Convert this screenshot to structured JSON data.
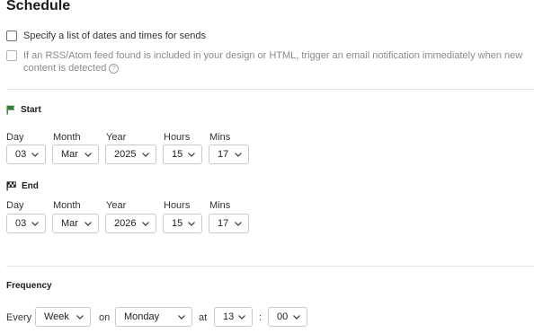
{
  "title": "Schedule",
  "options": {
    "specify_list": "Specify a list of dates and times for sends",
    "rss_trigger": "If an RSS/Atom feed found is included in your design or HTML, trigger an email notification immediately when new content is detected",
    "help_glyph": "?"
  },
  "start": {
    "heading": "Start",
    "icon": "flag-icon",
    "labels": {
      "day": "Day",
      "month": "Month",
      "year": "Year",
      "hours": "Hours",
      "mins": "Mins"
    },
    "values": {
      "day": "03",
      "month": "Mar",
      "year": "2025",
      "hours": "15",
      "mins": "17"
    }
  },
  "end": {
    "heading": "End",
    "icon": "checkered-flag-icon",
    "labels": {
      "day": "Day",
      "month": "Month",
      "year": "Year",
      "hours": "Hours",
      "mins": "Mins"
    },
    "values": {
      "day": "03",
      "month": "Mar",
      "year": "2026",
      "hours": "15",
      "mins": "17"
    }
  },
  "frequency": {
    "heading": "Frequency",
    "every_label": "Every",
    "unit": "Week",
    "on_label": "on",
    "weekday": "Monday",
    "at_label": "at",
    "hour": "13",
    "colon": ":",
    "minute": "00"
  },
  "colors": {
    "start_flag": "#2e7d32",
    "border": "#c9c9c9"
  }
}
